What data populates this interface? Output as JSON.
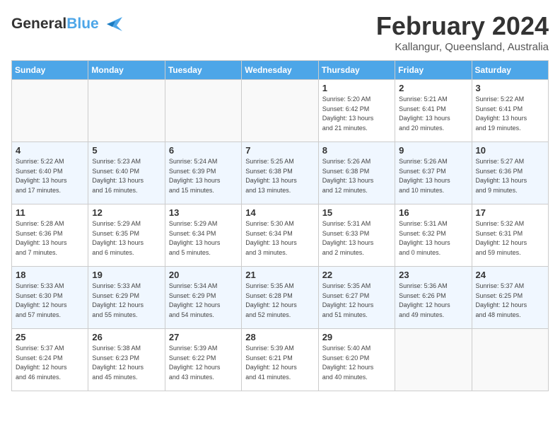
{
  "header": {
    "logo_line1": "General",
    "logo_line2": "Blue",
    "month_title": "February 2024",
    "location": "Kallangur, Queensland, Australia"
  },
  "days_of_week": [
    "Sunday",
    "Monday",
    "Tuesday",
    "Wednesday",
    "Thursday",
    "Friday",
    "Saturday"
  ],
  "weeks": [
    {
      "days": [
        {
          "num": "",
          "info": ""
        },
        {
          "num": "",
          "info": ""
        },
        {
          "num": "",
          "info": ""
        },
        {
          "num": "",
          "info": ""
        },
        {
          "num": "1",
          "info": "Sunrise: 5:20 AM\nSunset: 6:42 PM\nDaylight: 13 hours\nand 21 minutes."
        },
        {
          "num": "2",
          "info": "Sunrise: 5:21 AM\nSunset: 6:41 PM\nDaylight: 13 hours\nand 20 minutes."
        },
        {
          "num": "3",
          "info": "Sunrise: 5:22 AM\nSunset: 6:41 PM\nDaylight: 13 hours\nand 19 minutes."
        }
      ]
    },
    {
      "days": [
        {
          "num": "4",
          "info": "Sunrise: 5:22 AM\nSunset: 6:40 PM\nDaylight: 13 hours\nand 17 minutes."
        },
        {
          "num": "5",
          "info": "Sunrise: 5:23 AM\nSunset: 6:40 PM\nDaylight: 13 hours\nand 16 minutes."
        },
        {
          "num": "6",
          "info": "Sunrise: 5:24 AM\nSunset: 6:39 PM\nDaylight: 13 hours\nand 15 minutes."
        },
        {
          "num": "7",
          "info": "Sunrise: 5:25 AM\nSunset: 6:38 PM\nDaylight: 13 hours\nand 13 minutes."
        },
        {
          "num": "8",
          "info": "Sunrise: 5:26 AM\nSunset: 6:38 PM\nDaylight: 13 hours\nand 12 minutes."
        },
        {
          "num": "9",
          "info": "Sunrise: 5:26 AM\nSunset: 6:37 PM\nDaylight: 13 hours\nand 10 minutes."
        },
        {
          "num": "10",
          "info": "Sunrise: 5:27 AM\nSunset: 6:36 PM\nDaylight: 13 hours\nand 9 minutes."
        }
      ]
    },
    {
      "days": [
        {
          "num": "11",
          "info": "Sunrise: 5:28 AM\nSunset: 6:36 PM\nDaylight: 13 hours\nand 7 minutes."
        },
        {
          "num": "12",
          "info": "Sunrise: 5:29 AM\nSunset: 6:35 PM\nDaylight: 13 hours\nand 6 minutes."
        },
        {
          "num": "13",
          "info": "Sunrise: 5:29 AM\nSunset: 6:34 PM\nDaylight: 13 hours\nand 5 minutes."
        },
        {
          "num": "14",
          "info": "Sunrise: 5:30 AM\nSunset: 6:34 PM\nDaylight: 13 hours\nand 3 minutes."
        },
        {
          "num": "15",
          "info": "Sunrise: 5:31 AM\nSunset: 6:33 PM\nDaylight: 13 hours\nand 2 minutes."
        },
        {
          "num": "16",
          "info": "Sunrise: 5:31 AM\nSunset: 6:32 PM\nDaylight: 13 hours\nand 0 minutes."
        },
        {
          "num": "17",
          "info": "Sunrise: 5:32 AM\nSunset: 6:31 PM\nDaylight: 12 hours\nand 59 minutes."
        }
      ]
    },
    {
      "days": [
        {
          "num": "18",
          "info": "Sunrise: 5:33 AM\nSunset: 6:30 PM\nDaylight: 12 hours\nand 57 minutes."
        },
        {
          "num": "19",
          "info": "Sunrise: 5:33 AM\nSunset: 6:29 PM\nDaylight: 12 hours\nand 55 minutes."
        },
        {
          "num": "20",
          "info": "Sunrise: 5:34 AM\nSunset: 6:29 PM\nDaylight: 12 hours\nand 54 minutes."
        },
        {
          "num": "21",
          "info": "Sunrise: 5:35 AM\nSunset: 6:28 PM\nDaylight: 12 hours\nand 52 minutes."
        },
        {
          "num": "22",
          "info": "Sunrise: 5:35 AM\nSunset: 6:27 PM\nDaylight: 12 hours\nand 51 minutes."
        },
        {
          "num": "23",
          "info": "Sunrise: 5:36 AM\nSunset: 6:26 PM\nDaylight: 12 hours\nand 49 minutes."
        },
        {
          "num": "24",
          "info": "Sunrise: 5:37 AM\nSunset: 6:25 PM\nDaylight: 12 hours\nand 48 minutes."
        }
      ]
    },
    {
      "days": [
        {
          "num": "25",
          "info": "Sunrise: 5:37 AM\nSunset: 6:24 PM\nDaylight: 12 hours\nand 46 minutes."
        },
        {
          "num": "26",
          "info": "Sunrise: 5:38 AM\nSunset: 6:23 PM\nDaylight: 12 hours\nand 45 minutes."
        },
        {
          "num": "27",
          "info": "Sunrise: 5:39 AM\nSunset: 6:22 PM\nDaylight: 12 hours\nand 43 minutes."
        },
        {
          "num": "28",
          "info": "Sunrise: 5:39 AM\nSunset: 6:21 PM\nDaylight: 12 hours\nand 41 minutes."
        },
        {
          "num": "29",
          "info": "Sunrise: 5:40 AM\nSunset: 6:20 PM\nDaylight: 12 hours\nand 40 minutes."
        },
        {
          "num": "",
          "info": ""
        },
        {
          "num": "",
          "info": ""
        }
      ]
    }
  ]
}
